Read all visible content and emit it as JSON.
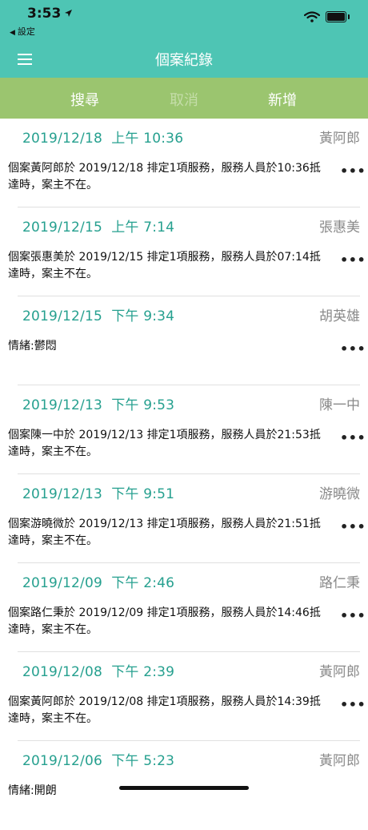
{
  "status_bar": {
    "time": "3:53",
    "back_app": "設定"
  },
  "nav": {
    "title": "個案紀錄"
  },
  "toolbar": {
    "search": "搜尋",
    "cancel": "取消",
    "add": "新增"
  },
  "records": [
    {
      "date": "2019/12/18",
      "ampm": "上午",
      "time": "10:36",
      "name": "黃阿郎",
      "body": "個案黃阿郎於 2019/12/18 排定1項服務，服務人員於10:36抵達時，案主不在。"
    },
    {
      "date": "2019/12/15",
      "ampm": "上午",
      "time": "7:14",
      "name": "張惠美",
      "body": "個案張惠美於 2019/12/15 排定1項服務，服務人員於07:14抵達時，案主不在。"
    },
    {
      "date": "2019/12/15",
      "ampm": "下午",
      "time": "9:34",
      "name": "胡英雄",
      "body": "情緒:鬱悶"
    },
    {
      "date": "2019/12/13",
      "ampm": "下午",
      "time": "9:53",
      "name": "陳一中",
      "body": "個案陳一中於 2019/12/13 排定1項服務，服務人員於21:53抵達時，案主不在。"
    },
    {
      "date": "2019/12/13",
      "ampm": "下午",
      "time": "9:51",
      "name": "游曉微",
      "body": "個案游曉微於 2019/12/13 排定1項服務，服務人員於21:51抵達時，案主不在。"
    },
    {
      "date": "2019/12/09",
      "ampm": "下午",
      "time": "2:46",
      "name": "路仁秉",
      "body": "個案路仁秉於 2019/12/09 排定1項服務，服務人員於14:46抵達時，案主不在。"
    },
    {
      "date": "2019/12/08",
      "ampm": "下午",
      "time": "2:39",
      "name": "黃阿郎",
      "body": "個案黃阿郎於 2019/12/08 排定1項服務，服務人員於14:39抵達時，案主不在。"
    },
    {
      "date": "2019/12/06",
      "ampm": "下午",
      "time": "5:23",
      "name": "黃阿郎",
      "body": "情緒:開朗"
    }
  ],
  "colors": {
    "header": "#4ec5b4",
    "toolbar": "#9bc56f",
    "date_text": "#26a08f",
    "name_text": "#8a8a8a"
  },
  "icons": {
    "menu": "hamburger-menu-icon",
    "more": "more-dots-icon",
    "wifi": "wifi-icon",
    "battery": "battery-icon",
    "location": "location-arrow-icon"
  }
}
